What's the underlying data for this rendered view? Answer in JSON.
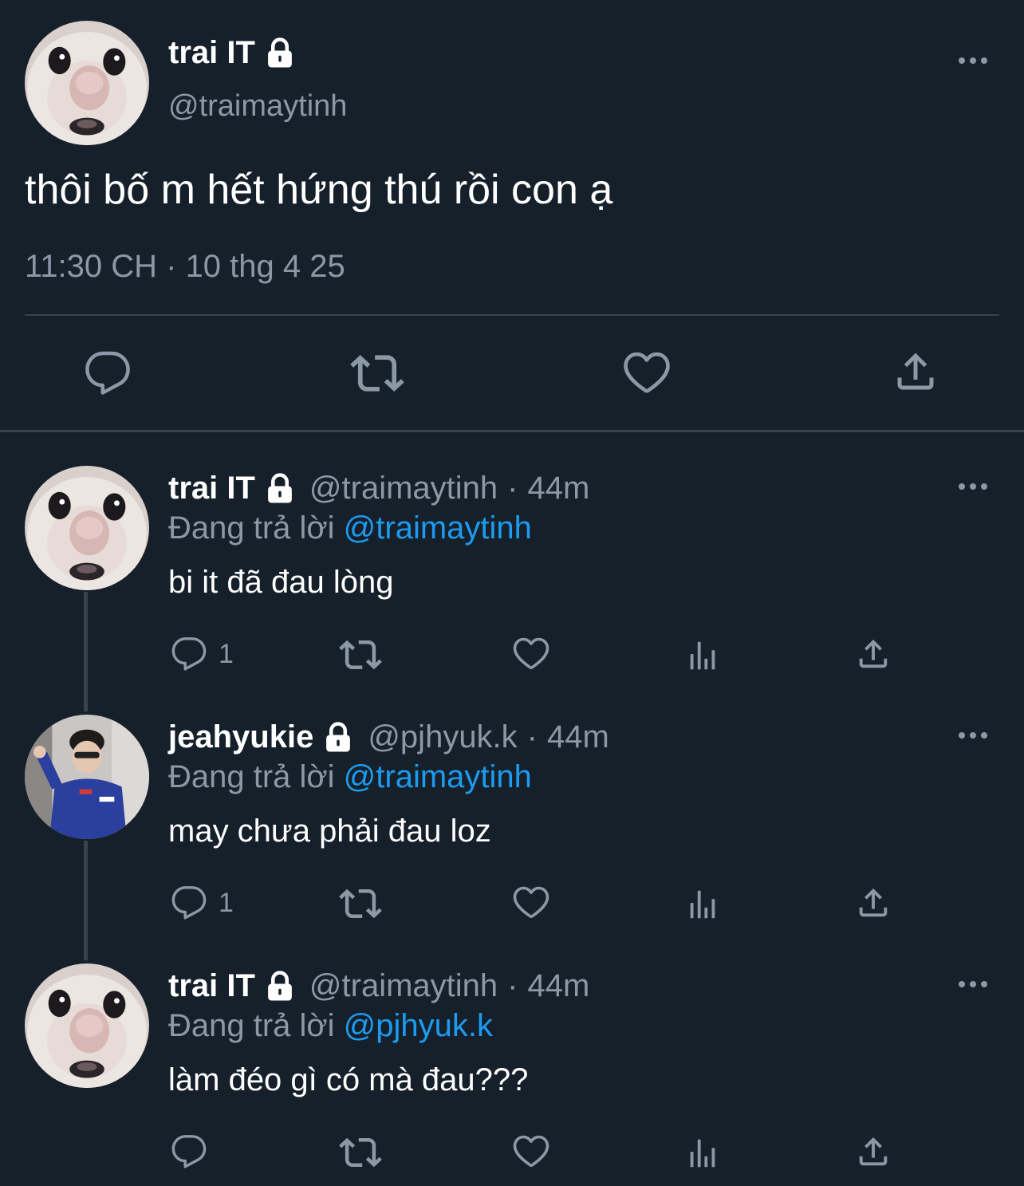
{
  "main_tweet": {
    "display_name": "trai IT",
    "handle": "@traimaytinh",
    "text": "thôi bố m hết hứng thú rồi con ạ",
    "timestamp": "11:30 CH · 10 thg 4 25",
    "actions": [
      "reply-icon",
      "retweet-icon",
      "like-icon",
      "share-icon"
    ]
  },
  "replies": [
    {
      "display_name": "trai IT",
      "handle": "@traimaytinh",
      "time": "44m",
      "replying_label": "Đang trả lời",
      "replying_to": "@traimaytinh",
      "text": "bi it đã đau lòng",
      "reply_count": "1"
    },
    {
      "display_name": "jeahyukie",
      "handle": "@pjhyuk.k",
      "time": "44m",
      "replying_label": "Đang trả lời",
      "replying_to": "@traimaytinh",
      "text": "may chưa phải đau loz",
      "reply_count": "1"
    },
    {
      "display_name": "trai IT",
      "handle": "@traimaytinh",
      "time": "44m",
      "replying_label": "Đang trả lời",
      "replying_to": "@pjhyuk.k",
      "text": "làm đéo gì có mà đau???",
      "reply_count": ""
    }
  ],
  "separator": "·",
  "colors": {
    "background": "#15202b",
    "secondary_text": "#8b98a5",
    "mention": "#1d9bf0",
    "divider": "#38444d"
  }
}
